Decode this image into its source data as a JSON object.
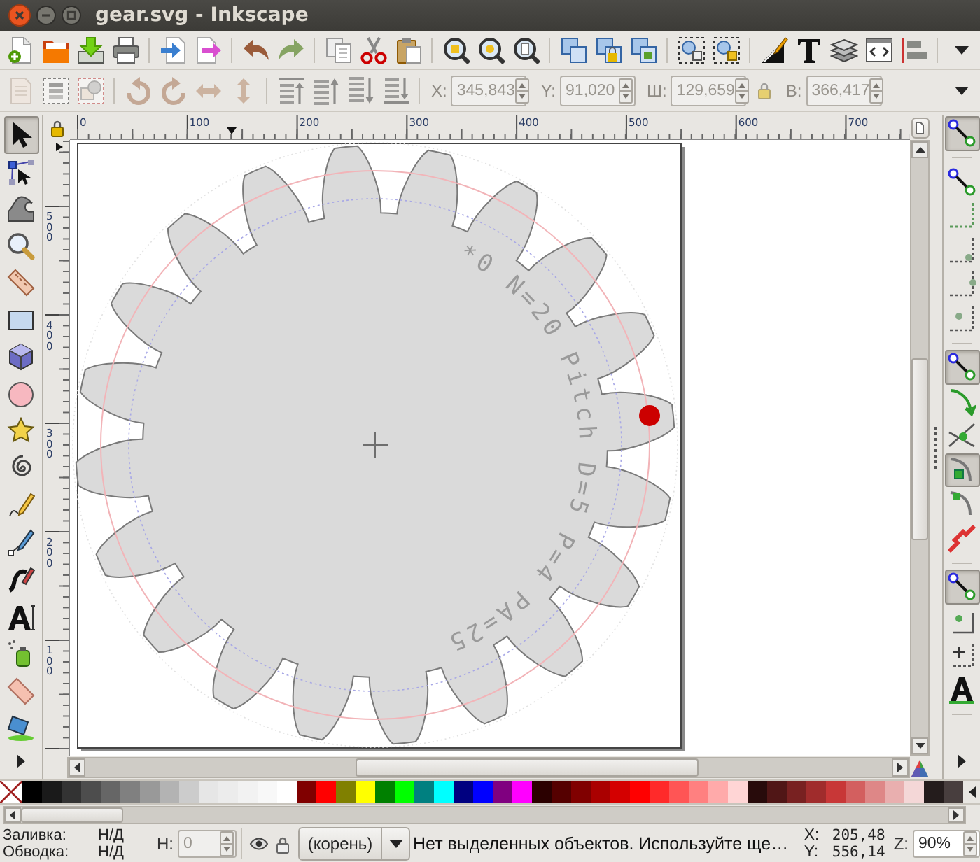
{
  "window": {
    "title": "gear.svg - Inkscape"
  },
  "transform_bar": {
    "fields": [
      {
        "label": "X:",
        "value": "345,843",
        "disabled": true
      },
      {
        "label": "Y:",
        "value": "91,020",
        "disabled": true
      },
      {
        "label": "Ш:",
        "value": "129,659",
        "disabled": true
      },
      {
        "label": "В:",
        "value": "366,417",
        "disabled": true
      }
    ]
  },
  "toolbox": {
    "tools": [
      {
        "selected": true
      },
      {
        "selected": false
      },
      {
        "selected": false
      },
      {
        "selected": false
      },
      {
        "selected": false
      },
      {
        "selected": false
      },
      {
        "selected": false
      },
      {
        "selected": false
      },
      {
        "selected": false
      },
      {
        "selected": false
      },
      {
        "selected": false
      },
      {
        "selected": false
      },
      {
        "selected": false
      },
      {
        "selected": false
      },
      {
        "selected": false
      },
      {
        "selected": false
      },
      {
        "selected": false
      }
    ]
  },
  "rulers": {
    "top_labels": [
      "0",
      "100",
      "200",
      "300",
      "400",
      "500",
      "600",
      "700"
    ],
    "side_labels": [
      "500",
      "400",
      "300",
      "200",
      "100"
    ]
  },
  "canvas": {
    "gear_label": "*0 N=20 Pitch D=5 P=4 PA=25"
  },
  "snap_bar": {
    "groups": [
      [
        {
          "on": true
        }
      ],
      [
        {
          "on": false
        },
        {
          "on": false
        },
        {
          "on": false
        },
        {
          "on": false
        },
        {
          "on": false
        }
      ],
      [
        {
          "on": true
        },
        {
          "on": false
        },
        {
          "on": false
        },
        {
          "on": true
        },
        {
          "on": false
        },
        {
          "on": false
        }
      ],
      [
        {
          "on": true
        },
        {
          "on": false
        },
        {
          "on": false
        },
        {
          "on": false
        }
      ]
    ]
  },
  "palette": [
    {
      "color": "#000000"
    },
    {
      "color": "#1a1a1a"
    },
    {
      "color": "#333333"
    },
    {
      "color": "#4d4d4d"
    },
    {
      "color": "#666666"
    },
    {
      "color": "#808080"
    },
    {
      "color": "#999999"
    },
    {
      "color": "#b3b3b3"
    },
    {
      "color": "#cccccc"
    },
    {
      "color": "#e6e6e6"
    },
    {
      "color": "#ececec"
    },
    {
      "color": "#f2f2f2"
    },
    {
      "color": "#f8f8f8"
    },
    {
      "color": "#ffffff"
    },
    {
      "color": "#800000"
    },
    {
      "color": "#ff0000"
    },
    {
      "color": "#808000"
    },
    {
      "color": "#ffff00"
    },
    {
      "color": "#008000"
    },
    {
      "color": "#00ff00"
    },
    {
      "color": "#008080"
    },
    {
      "color": "#00ffff"
    },
    {
      "color": "#000080"
    },
    {
      "color": "#0000ff"
    },
    {
      "color": "#800080"
    },
    {
      "color": "#ff00ff"
    },
    {
      "color": "#2b0000"
    },
    {
      "color": "#550000"
    },
    {
      "color": "#800000"
    },
    {
      "color": "#aa0000"
    },
    {
      "color": "#d40000"
    },
    {
      "color": "#ff0000"
    },
    {
      "color": "#ff2a2a"
    },
    {
      "color": "#ff5555"
    },
    {
      "color": "#ff8080"
    },
    {
      "color": "#ffaaaa"
    },
    {
      "color": "#ffd5d5"
    },
    {
      "color": "#280b0b"
    },
    {
      "color": "#501616"
    },
    {
      "color": "#782121"
    },
    {
      "color": "#a02c2c"
    },
    {
      "color": "#c83737"
    },
    {
      "color": "#d35f5f"
    },
    {
      "color": "#de8787"
    },
    {
      "color": "#e9afaf"
    },
    {
      "color": "#f4d7d7"
    },
    {
      "color": "#241c1c"
    },
    {
      "color": "#483e3e"
    }
  ],
  "status_bar": {
    "style": [
      {
        "label": "Заливка:",
        "value": "Н/Д"
      },
      {
        "label": "Обводка:",
        "value": "Н/Д"
      }
    ],
    "opacity": {
      "label": "Н:",
      "value": "0",
      "disabled": true
    },
    "layer": "(корень)",
    "message": "Нет выделенных объектов. Используйте ще…",
    "cursor": [
      {
        "label": "X:",
        "value": "205,48"
      },
      {
        "label": "Y:",
        "value": "556,14"
      }
    ],
    "zoom": {
      "label": "Z:",
      "value": "90%"
    }
  }
}
